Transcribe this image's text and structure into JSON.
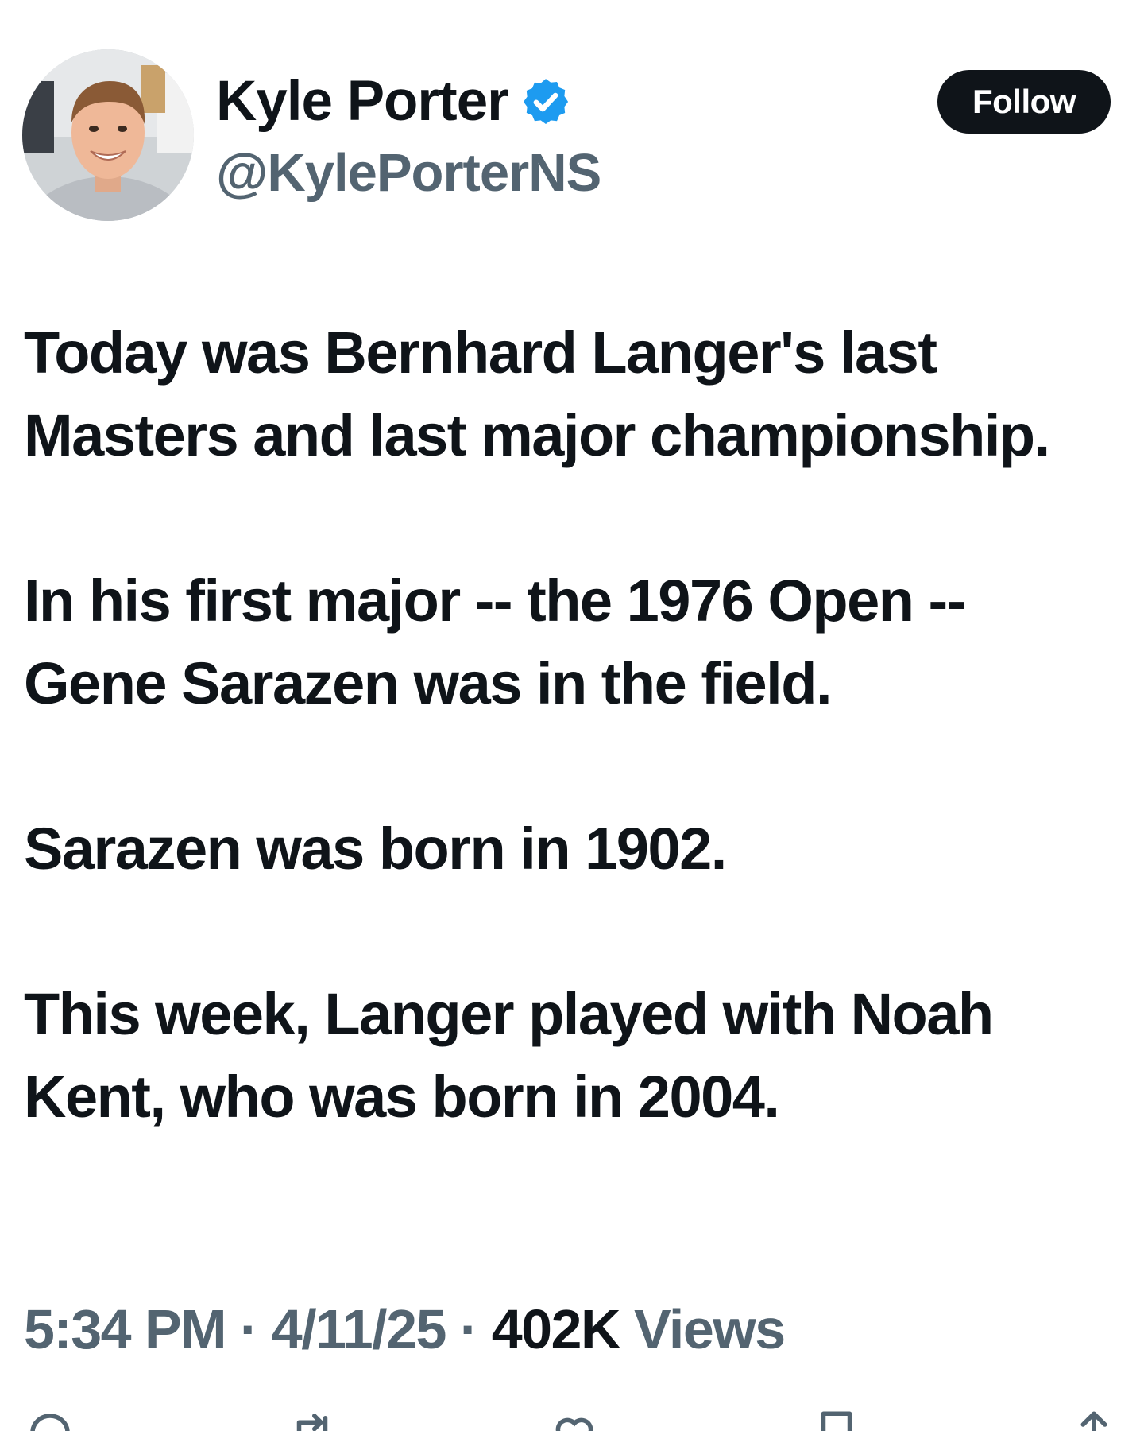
{
  "profile": {
    "display_name": "Kyle Porter",
    "handle": "@KylePorterNS",
    "verified": true
  },
  "follow_label": "Follow",
  "tweet": {
    "paragraphs": [
      "Today was Bernhard Langer's last Masters and last major championship.",
      "In his first major -- the 1976 Open -- Gene Sarazen was in the field.",
      "Sarazen was born in 1902.",
      "This week, Langer played with Noah Kent, who was born in 2004."
    ]
  },
  "meta": {
    "time": "5:34 PM",
    "date": "4/11/25",
    "views_count": "402K",
    "views_label": "Views",
    "separator": "·"
  },
  "icons": {
    "reply": "reply-icon",
    "repost": "repost-icon",
    "like": "heart-icon",
    "bookmark": "bookmark-icon",
    "share": "share-icon"
  },
  "colors": {
    "text": "#0f1419",
    "secondary": "#536471",
    "verified": "#1d9bf0",
    "follow_bg": "#0f1419"
  }
}
